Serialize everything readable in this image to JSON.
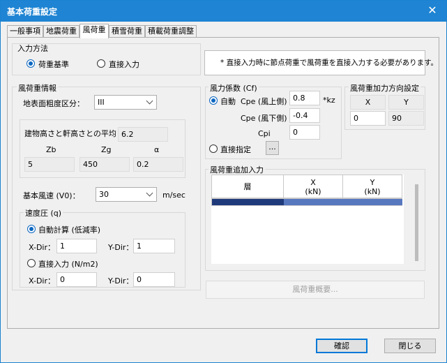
{
  "window": {
    "title": "基本荷重設定",
    "close_glyph": "✕"
  },
  "tabs": [
    {
      "label": "一般事項"
    },
    {
      "label": "地震荷重"
    },
    {
      "label": "風荷重"
    },
    {
      "label": "積雪荷重"
    },
    {
      "label": "積載荷重調整"
    }
  ],
  "input_method": {
    "title": "入力方法",
    "options": [
      "荷重基準",
      "直接入力"
    ],
    "selected": "荷重基準",
    "note": "* 直接入力時に節点荷重で風荷重を直接入力する必要があります。"
  },
  "wind_info": {
    "title": "風荷重情報",
    "roughness_label": "地表面粗度区分：",
    "roughness_value": "III",
    "avg_height_label": "建物高さと軒高さとの平均",
    "avg_height_value": "6.2",
    "zb_label": "Zb",
    "zg_label": "Zg",
    "alpha_label": "α",
    "zb_value": "5",
    "zg_value": "450",
    "alpha_value": "0.2",
    "basic_speed_label": "基本風速 (V0)：",
    "basic_speed_value": "30",
    "basic_speed_unit": "m/sec",
    "velocity": {
      "title": "速度圧 (q)",
      "auto_label": "自動計算 (低減率)",
      "auto_xdir_label": "X-Dir：",
      "auto_xdir_value": "1",
      "auto_ydir_label": "Y-Dir：",
      "auto_ydir_value": "1",
      "direct_label": "直接入力 (N/m2)",
      "direct_xdir_label": "X-Dir：",
      "direct_xdir_value": "0",
      "direct_ydir_label": "Y-Dir：",
      "direct_ydir_value": "0",
      "selected": "auto"
    }
  },
  "wind_coef": {
    "title": "風力係数 (Cf)",
    "auto_label": "自動",
    "cpe_windward_label": "Cpe (風上側)",
    "cpe_windward_value": "0.8",
    "kz_label": "*kz",
    "cpe_leeward_label": "Cpe (風下側)",
    "cpe_leeward_value": "-0.4",
    "cpi_label": "Cpi",
    "cpi_value": "0",
    "direct_label": "直接指定",
    "ellipsis_label": "...",
    "selected": "auto"
  },
  "direction": {
    "title": "風荷重加力方向設定",
    "x_header": "X",
    "y_header": "Y",
    "x_value": "0",
    "y_value": "90"
  },
  "additional": {
    "title": "風荷重追加入力",
    "columns": [
      {
        "line1": "層",
        "line2": ""
      },
      {
        "line1": "X",
        "line2": "(kN)"
      },
      {
        "line1": "Y",
        "line2": "(kN)"
      }
    ],
    "selection_color": "#1f3a7a",
    "cell_color": "#5777bf"
  },
  "summary_button": "風荷重概要...",
  "ok_button": "確認",
  "close_button": "閉じる"
}
